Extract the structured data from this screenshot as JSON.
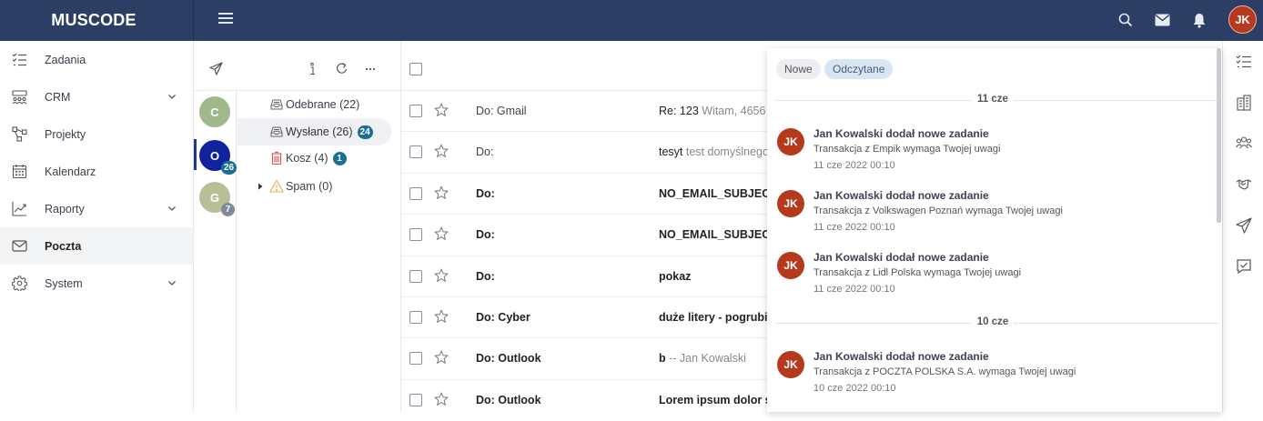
{
  "app": {
    "logo": "MUSCODE",
    "user_initials": "JK"
  },
  "topbar": {
    "icons": [
      "search-icon",
      "mail-icon",
      "bell-icon"
    ]
  },
  "sidebar": {
    "items": [
      {
        "label": "Zadania",
        "icon": "tasks-icon",
        "expandable": false,
        "active": false
      },
      {
        "label": "CRM",
        "icon": "crm-icon",
        "expandable": true,
        "active": false
      },
      {
        "label": "Projekty",
        "icon": "projects-icon",
        "expandable": false,
        "active": false
      },
      {
        "label": "Kalendarz",
        "icon": "calendar-icon",
        "expandable": false,
        "active": false
      },
      {
        "label": "Raporty",
        "icon": "reports-icon",
        "expandable": true,
        "active": false
      },
      {
        "label": "Poczta",
        "icon": "mail-icon",
        "expandable": false,
        "active": true
      },
      {
        "label": "System",
        "icon": "gear-icon",
        "expandable": true,
        "active": false
      }
    ]
  },
  "accounts": [
    {
      "initial": "C",
      "color": "#9fb98d",
      "badge": ""
    },
    {
      "initial": "O",
      "color": "#12219c",
      "badge": "26",
      "badge_color": "#1a6f95",
      "active": true
    },
    {
      "initial": "G",
      "color": "#b7bf97",
      "badge": "7",
      "badge_color": "#7d8a99"
    }
  ],
  "folders": [
    {
      "label": "Odebrane (22)",
      "badge": "",
      "icon": "inbox-icon"
    },
    {
      "label": "Wysłane (26)",
      "badge": "24",
      "icon": "sent-icon",
      "active": true
    },
    {
      "label": "Kosz (4)",
      "badge": "1",
      "icon": "trash-icon"
    },
    {
      "label": "Spam (0)",
      "badge": "",
      "icon": "warning-icon",
      "collapsible": true
    }
  ],
  "emails": [
    {
      "to": "Do: Gmail",
      "subject": "Re: 123",
      "preview": " Witam, 4656",
      "unread": false
    },
    {
      "to": "Do:",
      "subject": "tesyt",
      "preview": " test domyślnego",
      "unread": false
    },
    {
      "to": "Do:",
      "subject": "NO_EMAIL_SUBJECT",
      "preview": "",
      "unread": true
    },
    {
      "to": "Do:",
      "subject": "NO_EMAIL_SUBJECT",
      "preview": "",
      "unread": true
    },
    {
      "to": "Do:",
      "subject": "pokaz",
      "preview": "",
      "unread": true
    },
    {
      "to": "Do: Cyber",
      "subject": "duże litery - pogrubie",
      "preview": "",
      "unread": true
    },
    {
      "to": "Do: Outlook",
      "subject": "b",
      "preview": " -- Jan Kowalski",
      "unread": true
    },
    {
      "to": "Do: Outlook",
      "subject": "Lorem ipsum dolor si",
      "preview": "",
      "unread": true
    }
  ],
  "notifications": {
    "tabs": [
      {
        "label": "Nowe",
        "active": false
      },
      {
        "label": "Odczytane",
        "active": true
      }
    ],
    "groups": [
      {
        "date": "11 cze",
        "items": [
          {
            "initials": "JK",
            "title": "Jan Kowalski dodał nowe zadanie",
            "desc": "Transakcja z Empik wymaga Twojej uwagi",
            "time": "11 cze 2022 00:10"
          },
          {
            "initials": "JK",
            "title": "Jan Kowalski dodał nowe zadanie",
            "desc": "Transakcja z Volkswagen Poznań wymaga Twojej uwagi",
            "time": "11 cze 2022 00:10"
          },
          {
            "initials": "JK",
            "title": "Jan Kowalski dodał nowe zadanie",
            "desc": "Transakcja z Lidl Polska wymaga Twojej uwagi",
            "time": "11 cze 2022 00:10"
          }
        ]
      },
      {
        "date": "10 cze",
        "items": [
          {
            "initials": "JK",
            "title": "Jan Kowalski dodał nowe zadanie",
            "desc": "Transakcja z POCZTA POLSKA S.A. wymaga Twojej uwagi",
            "time": "10 cze 2022 00:10"
          }
        ]
      }
    ]
  },
  "rightbar": {
    "icons": [
      "tasks-icon",
      "buildings-icon",
      "users-icon",
      "handshake-icon",
      "send-icon",
      "chat-check-icon"
    ]
  }
}
